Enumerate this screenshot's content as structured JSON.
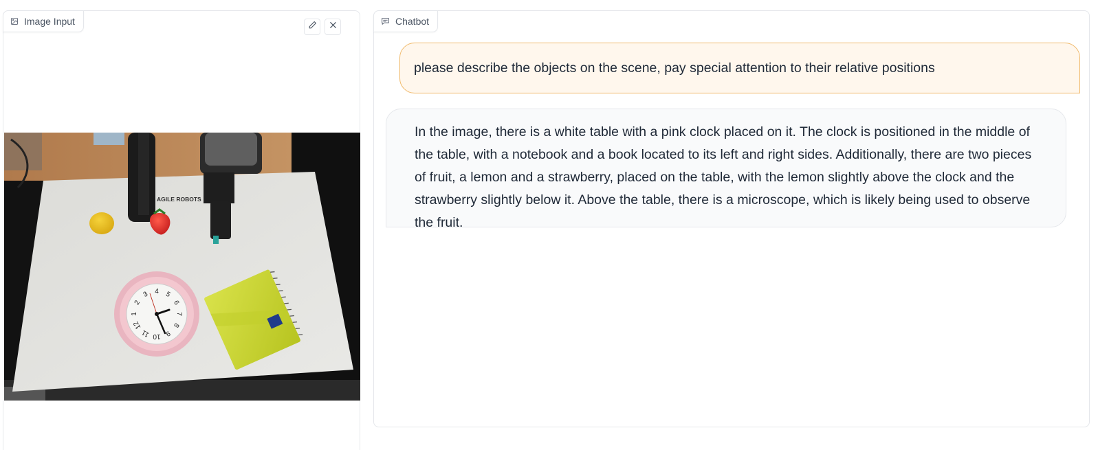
{
  "image_panel": {
    "label": "Image Input",
    "icons": [
      "image-icon",
      "edit-icon",
      "close-icon"
    ]
  },
  "chat_panel": {
    "label": "Chatbot",
    "icons": [
      "chat-icon"
    ],
    "messages": [
      {
        "role": "user",
        "text": "please describe the objects on the scene, pay special attention to their relative positions"
      },
      {
        "role": "bot",
        "text": "In the image, there is a white table with a pink clock placed on it. The clock is positioned in the middle of the table, with a notebook and a book located to its left and right sides. Additionally, there are two pieces of fruit, a lemon and a strawberry, placed on the table, with the lemon slightly above the clock and the strawberry slightly below it. Above the table, there is a microscope, which is likely being used to observe the fruit."
      }
    ]
  },
  "photo": {
    "robot_brand_text": "AGILE ROBOTS",
    "clock_numerals": [
      "12",
      "1",
      "2",
      "3",
      "4",
      "5",
      "6",
      "7",
      "8",
      "9",
      "10",
      "11"
    ]
  },
  "colors": {
    "user_bubble_bg": "#fff7ed",
    "user_bubble_border": "#f0b96a",
    "bot_bubble_bg": "#f9fafb",
    "border": "#e5e7eb"
  }
}
